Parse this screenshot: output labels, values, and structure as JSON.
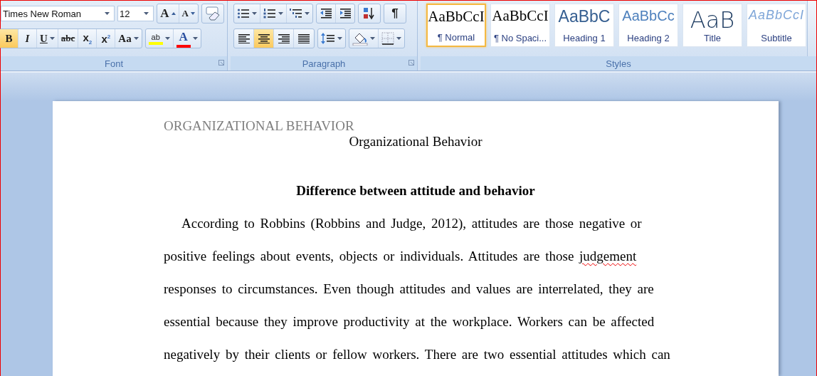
{
  "ribbon": {
    "font_group": {
      "label": "Font",
      "font_name": "Times New Roman",
      "font_size": "12",
      "row1": [
        {
          "kind": "grow",
          "label": "A"
        },
        {
          "kind": "shrink",
          "label": "A"
        },
        {
          "kind": "clear"
        }
      ],
      "row2": [
        {
          "kind": "bold",
          "label": "B",
          "selected": true
        },
        {
          "kind": "italic",
          "label": "I",
          "selected": false
        },
        {
          "kind": "underline",
          "label": "U",
          "selected": false
        },
        {
          "kind": "strike",
          "label": "abc",
          "selected": false
        },
        {
          "kind": "subscript",
          "label": "x$_{2}$",
          "selected": false
        },
        {
          "kind": "superscript",
          "label": "x$^{2}$",
          "selected": false
        },
        {
          "kind": "case",
          "label": "Aa"
        }
      ],
      "row2b": [
        {
          "kind": "highlight",
          "label": "ab",
          "color": "#ffff00"
        },
        {
          "kind": "fontcolor",
          "label": "A",
          "color": "#ff0000"
        }
      ]
    },
    "paragraph_group": {
      "label": "Paragraph",
      "row1": [
        {
          "kind": "bullets"
        },
        {
          "kind": "numbering"
        },
        {
          "kind": "multilevel"
        },
        {
          "kind": "outdent"
        },
        {
          "kind": "indent"
        },
        {
          "kind": "sort"
        },
        {
          "kind": "marks",
          "label": "¶"
        }
      ],
      "alignment": [
        {
          "kind": "left",
          "selected": false
        },
        {
          "kind": "center",
          "selected": true
        },
        {
          "kind": "right",
          "selected": false
        },
        {
          "kind": "justify",
          "selected": false
        }
      ],
      "row2": [
        {
          "kind": "spacing"
        },
        {
          "kind": "shading"
        },
        {
          "kind": "borders"
        }
      ]
    },
    "styles_group": {
      "label": "Styles",
      "tiles": [
        {
          "kind": "normal",
          "preview": "AaBbCcI",
          "name": "¶ Normal",
          "selected": true
        },
        {
          "kind": "nospacing",
          "preview": "AaBbCcI",
          "name": "¶ No Spaci...",
          "selected": false
        },
        {
          "kind": "heading1",
          "preview": "AaBbC",
          "name": "Heading 1",
          "selected": false
        },
        {
          "kind": "heading2",
          "preview": "AaBbCc",
          "name": "Heading 2",
          "selected": false
        },
        {
          "kind": "title",
          "preview": "AaB",
          "name": "Title",
          "selected": false
        },
        {
          "kind": "subtitle",
          "preview": "AaBbCcI",
          "name": "Subtitle",
          "selected": false
        }
      ]
    }
  },
  "document": {
    "header": "ORGANIZATIONAL BEHAVIOR",
    "title": "Organizational Behavior",
    "heading": "Difference between attitude and behavior",
    "lines": [
      {
        "indent": true,
        "segments": [
          {
            "text": "According to Robbins (Robbins and Judge, 2012), attitudes are those negative or",
            "misspelled": false
          }
        ]
      },
      {
        "indent": false,
        "segments": [
          {
            "text": "positive feelings about events, objects or individuals. Attitudes are those ",
            "misspelled": false
          },
          {
            "text": "judgement",
            "misspelled": true
          }
        ]
      },
      {
        "indent": false,
        "segments": [
          {
            "text": "responses to circumstances. Even though attitudes and values are interrelated, they are",
            "misspelled": false
          }
        ]
      },
      {
        "indent": false,
        "segments": [
          {
            "text": "essential because they improve productivity at the workplace. Workers can be affected",
            "misspelled": false
          }
        ]
      },
      {
        "indent": false,
        "segments": [
          {
            "text": "negatively by their clients or fellow workers. There are two essential attitudes which can",
            "misspelled": false
          }
        ]
      }
    ]
  }
}
